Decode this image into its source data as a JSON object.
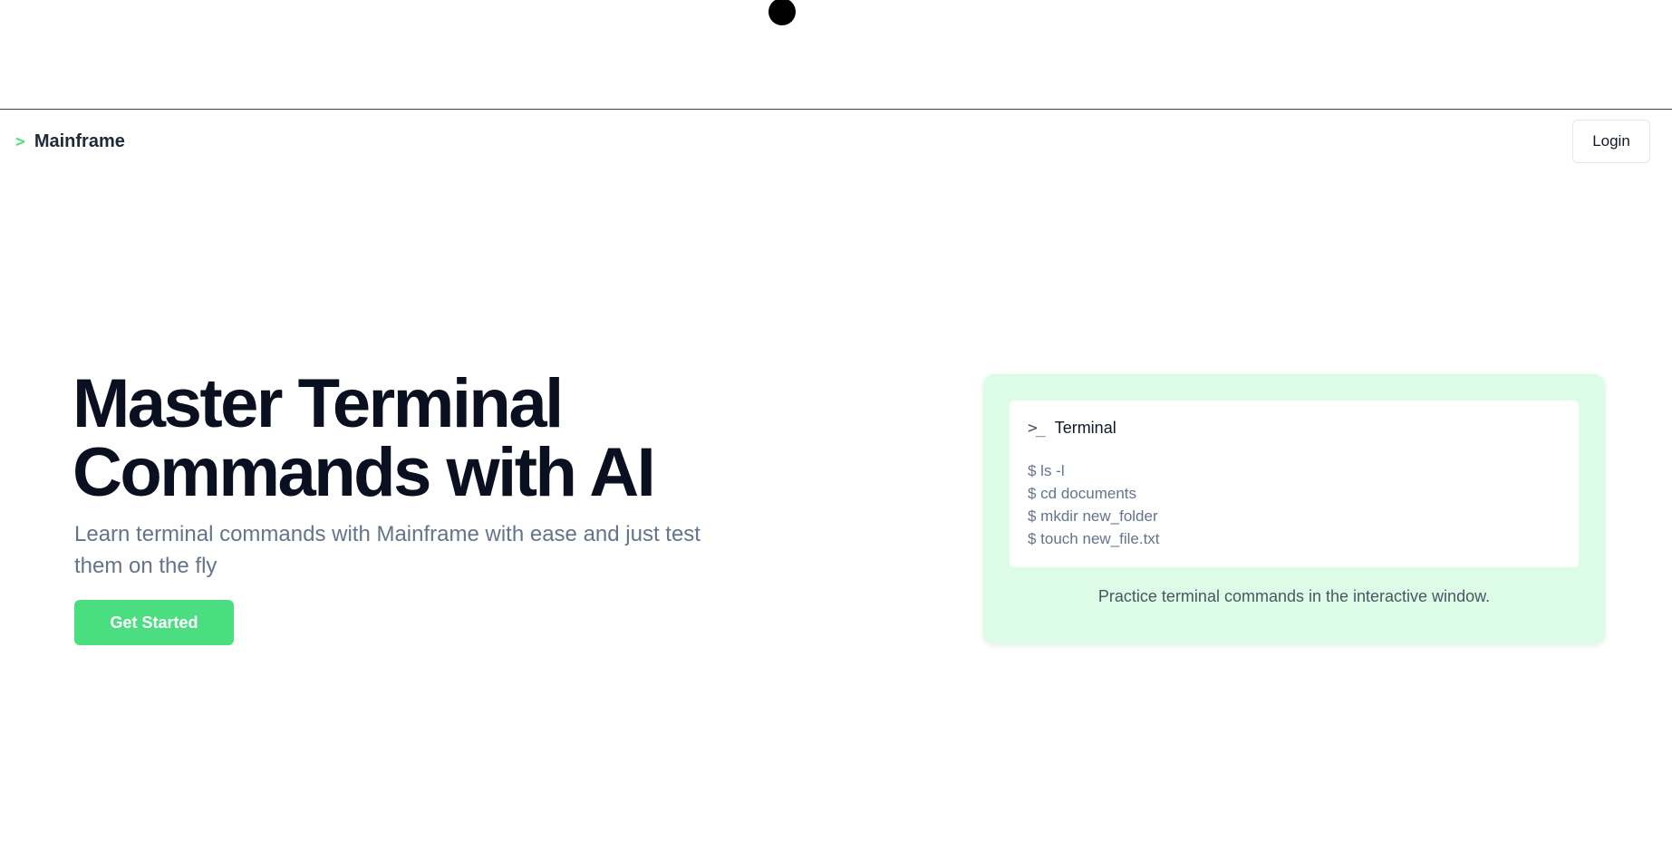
{
  "header": {
    "brand_icon": ">",
    "brand_name": "Mainframe",
    "login_label": "Login"
  },
  "hero": {
    "title": "Master Terminal Commands with AI",
    "subtitle": "Learn terminal commands with Mainframe with ease and just test them on the fly",
    "cta_label": "Get Started"
  },
  "terminal_card": {
    "icon": ">_",
    "title": "Terminal",
    "lines": [
      "$ ls -l",
      "$ cd documents",
      "$ mkdir new_folder",
      "$ touch new_file.txt"
    ],
    "caption": "Practice terminal commands in the interactive window."
  },
  "icons": {
    "brand": "chevron-right-icon",
    "terminal": "terminal-icon"
  },
  "colors": {
    "accent": "#4ade80",
    "card_bg": "#dcfce7",
    "heading": "#0b1020",
    "muted": "#64748b"
  }
}
